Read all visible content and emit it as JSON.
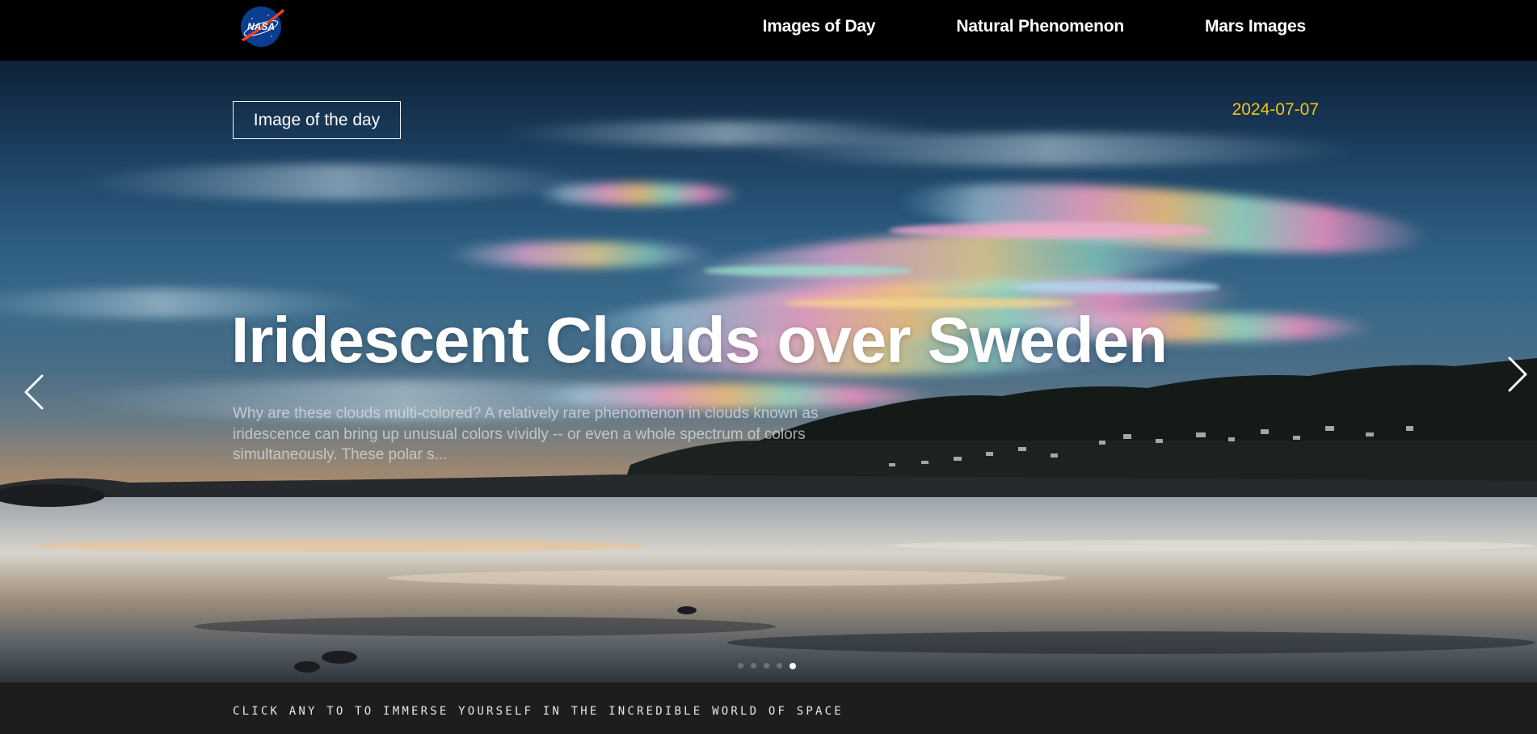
{
  "header": {
    "logo_text": "NASA",
    "nav": [
      {
        "label": "Images of Day"
      },
      {
        "label": "Natural Phenomenon"
      },
      {
        "label": "Mars Images"
      }
    ]
  },
  "hero": {
    "badge": "Image of the day",
    "date": "2024-07-07",
    "title": "Iridescent Clouds over Sweden",
    "description": "Why are these clouds multi-colored? A relatively rare phenomenon in clouds known as iridescence can bring up unusual colors vividly -- or even a whole spectrum of colors simultaneously. These polar s...",
    "prev_icon": "chevron-left-icon",
    "next_icon": "chevron-right-icon",
    "carousel": {
      "count": 5,
      "active_index": 4
    },
    "date_color": "#f0c21a"
  },
  "footer": {
    "text": "CLICK ANY TO TO IMMERSE YOURSELF IN THE INCREDIBLE WORLD OF SPACE"
  }
}
